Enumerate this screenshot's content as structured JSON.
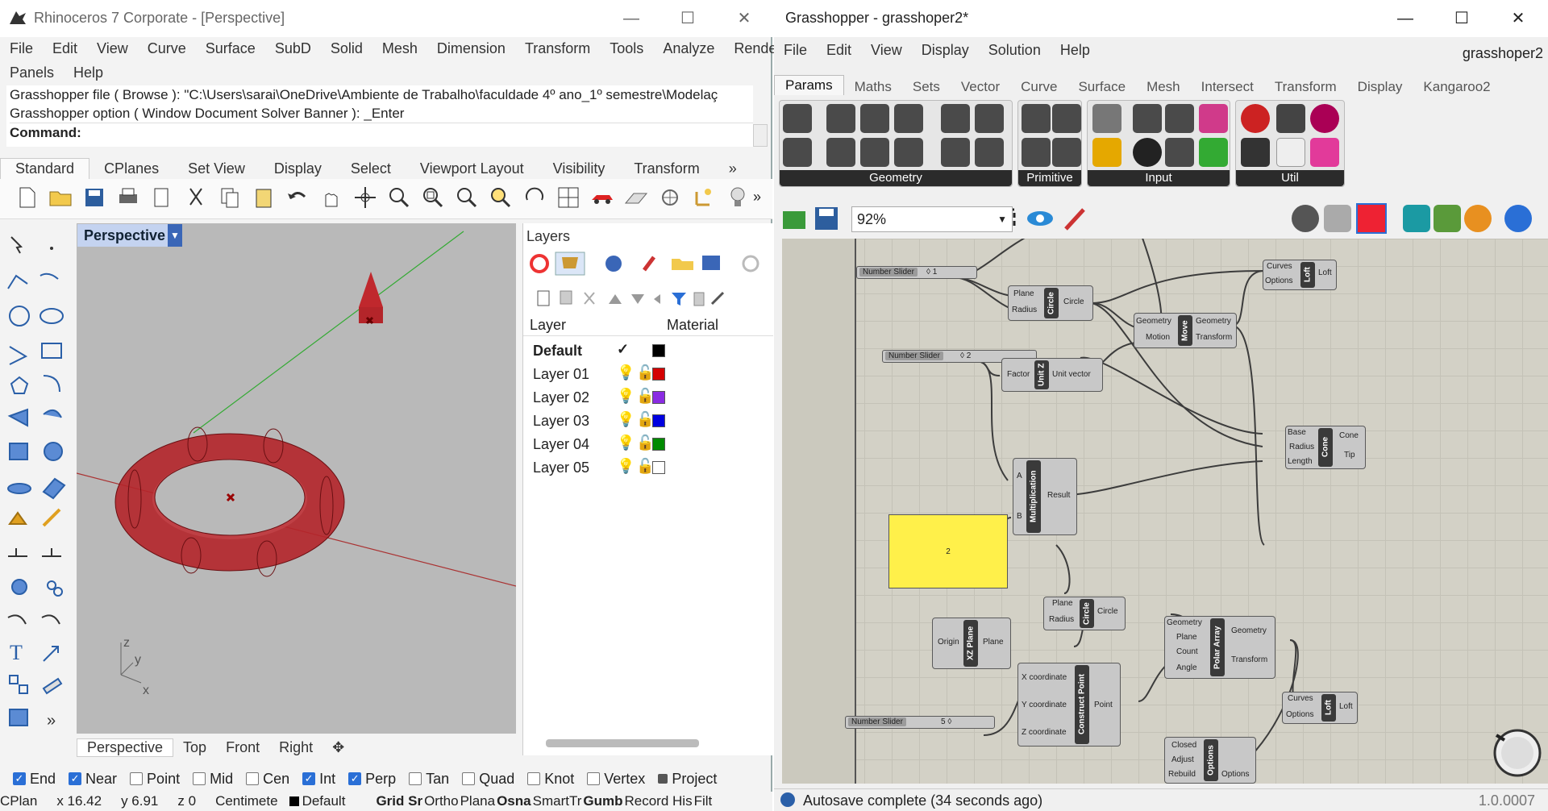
{
  "rhino": {
    "title": "Rhinoceros 7 Corporate - [Perspective]",
    "menu_row1": [
      "File",
      "Edit",
      "View",
      "Curve",
      "Surface",
      "SubD",
      "Solid",
      "Mesh",
      "Dimension",
      "Transform",
      "Tools",
      "Analyze",
      "Render"
    ],
    "menu_row2": [
      "Panels",
      "Help"
    ],
    "command_history": [
      "Grasshopper file ( Browse ): \"C:\\Users\\sarai\\OneDrive\\Ambiente de Trabalho\\faculdade 4º ano_1º semestre\\Modelaç",
      "Grasshopper option ( Window  Document  Solver  Banner ): _Enter"
    ],
    "command_label": "Command:",
    "toolbar_tabs": [
      "Standard",
      "CPlanes",
      "Set View",
      "Display",
      "Select",
      "Viewport Layout",
      "Visibility",
      "Transform"
    ],
    "toolbar_more": "»",
    "viewport": {
      "label": "Perspective",
      "tabs": [
        "Perspective",
        "Top",
        "Front",
        "Right"
      ],
      "axis_z": "z",
      "axis_y": "y",
      "axis_x": "x"
    },
    "layers": {
      "panel_title": "Layers",
      "col_layer": "Layer",
      "col_material": "Material",
      "rows": [
        {
          "name": "Default",
          "color": "#000000"
        },
        {
          "name": "Layer 01",
          "color": "#d40000"
        },
        {
          "name": "Layer 02",
          "color": "#8a2be2"
        },
        {
          "name": "Layer 03",
          "color": "#0000e0"
        },
        {
          "name": "Layer 04",
          "color": "#008a00"
        },
        {
          "name": "Layer 05",
          "color": "#ffffff"
        }
      ]
    },
    "osnaps": [
      {
        "label": "End",
        "checked": true
      },
      {
        "label": "Near",
        "checked": true
      },
      {
        "label": "Point",
        "checked": false
      },
      {
        "label": "Mid",
        "checked": false
      },
      {
        "label": "Cen",
        "checked": false
      },
      {
        "label": "Int",
        "checked": true
      },
      {
        "label": "Perp",
        "checked": true
      },
      {
        "label": "Tan",
        "checked": false
      },
      {
        "label": "Quad",
        "checked": false
      },
      {
        "label": "Knot",
        "checked": false
      },
      {
        "label": "Vertex",
        "checked": false
      },
      {
        "label": "Project",
        "checked": false
      }
    ],
    "status": {
      "cplane": "CPlan",
      "x": "x 16.42",
      "y": "y 6.91",
      "z": "z 0",
      "units": "Centimete",
      "layer": "Default",
      "toggles": [
        "Grid Sr",
        "Ortho",
        "Plana",
        "Osna",
        "SmartTr",
        "Gumb",
        "Record His",
        "Filt"
      ]
    }
  },
  "gh": {
    "title": "Grasshopper - grasshoper2*",
    "menu": [
      "File",
      "Edit",
      "View",
      "Display",
      "Solution",
      "Help"
    ],
    "doc_name": "grasshoper2",
    "tabs": [
      "Params",
      "Maths",
      "Sets",
      "Vector",
      "Curve",
      "Surface",
      "Mesh",
      "Intersect",
      "Transform",
      "Display",
      "Kangaroo2"
    ],
    "groups": [
      "Geometry",
      "Primitive",
      "Input",
      "Util"
    ],
    "zoom": "92%",
    "components": {
      "slider1": {
        "label": "Number Slider",
        "value": "◊ 1"
      },
      "slider2": {
        "label": "Number Slider",
        "value": "◊ 2"
      },
      "slider3": {
        "label": "Number Slider",
        "value": "5 ◊"
      },
      "circle1": {
        "name": "Circle",
        "in": [
          "Plane",
          "Radius"
        ],
        "out": [
          "Circle"
        ]
      },
      "move": {
        "name": "Move",
        "in": [
          "Geometry",
          "Motion"
        ],
        "out": [
          "Geometry",
          "Transform"
        ]
      },
      "loft1": {
        "name": "Loft",
        "in": [
          "Curves",
          "Options"
        ],
        "out": [
          "Loft"
        ]
      },
      "unitz": {
        "name": "Unit Z",
        "in": [
          "Factor"
        ],
        "out": [
          "Unit vector"
        ]
      },
      "cone": {
        "name": "Cone",
        "in": [
          "Base",
          "Radius",
          "Length"
        ],
        "out": [
          "Cone",
          "Tip"
        ]
      },
      "mult": {
        "name": "Multiplication",
        "in": [
          "A",
          "B"
        ],
        "out": [
          "Result"
        ]
      },
      "panel": {
        "value": "2"
      },
      "circle2": {
        "name": "Circle",
        "in": [
          "Plane",
          "Radius"
        ],
        "out": [
          "Circle"
        ]
      },
      "xzplane": {
        "name": "XZ Plane",
        "in": [
          "Origin"
        ],
        "out": [
          "Plane"
        ]
      },
      "polar": {
        "name": "Polar Array",
        "in": [
          "Geometry",
          "Plane",
          "Count",
          "Angle"
        ],
        "out": [
          "Geometry",
          "Transform"
        ]
      },
      "constpt": {
        "name": "Construct Point",
        "in": [
          "X coordinate",
          "Y coordinate",
          "Z coordinate"
        ],
        "out": [
          "Point"
        ]
      },
      "loft2": {
        "name": "Loft",
        "in": [
          "Curves",
          "Options"
        ],
        "out": [
          "Loft"
        ]
      },
      "options": {
        "name": "Options",
        "in": [
          "Closed",
          "Adjust",
          "Rebuild"
        ],
        "out": [
          "Options"
        ]
      }
    },
    "status_text": "Autosave complete (34 seconds ago)",
    "version": "1.0.0007"
  }
}
